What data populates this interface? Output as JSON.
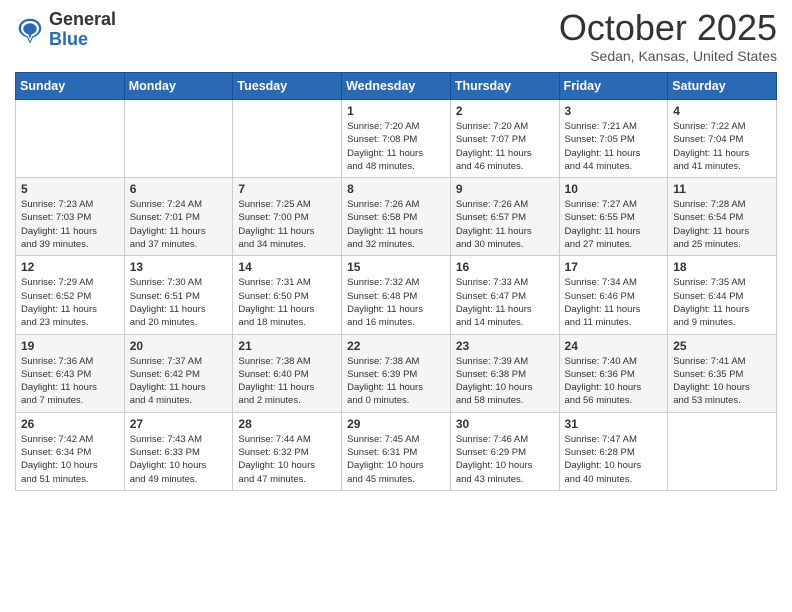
{
  "logo": {
    "general": "General",
    "blue": "Blue"
  },
  "header": {
    "month": "October 2025",
    "location": "Sedan, Kansas, United States"
  },
  "weekdays": [
    "Sunday",
    "Monday",
    "Tuesday",
    "Wednesday",
    "Thursday",
    "Friday",
    "Saturday"
  ],
  "weeks": [
    [
      {
        "day": "",
        "info": ""
      },
      {
        "day": "",
        "info": ""
      },
      {
        "day": "",
        "info": ""
      },
      {
        "day": "1",
        "info": "Sunrise: 7:20 AM\nSunset: 7:08 PM\nDaylight: 11 hours\nand 48 minutes."
      },
      {
        "day": "2",
        "info": "Sunrise: 7:20 AM\nSunset: 7:07 PM\nDaylight: 11 hours\nand 46 minutes."
      },
      {
        "day": "3",
        "info": "Sunrise: 7:21 AM\nSunset: 7:05 PM\nDaylight: 11 hours\nand 44 minutes."
      },
      {
        "day": "4",
        "info": "Sunrise: 7:22 AM\nSunset: 7:04 PM\nDaylight: 11 hours\nand 41 minutes."
      }
    ],
    [
      {
        "day": "5",
        "info": "Sunrise: 7:23 AM\nSunset: 7:03 PM\nDaylight: 11 hours\nand 39 minutes."
      },
      {
        "day": "6",
        "info": "Sunrise: 7:24 AM\nSunset: 7:01 PM\nDaylight: 11 hours\nand 37 minutes."
      },
      {
        "day": "7",
        "info": "Sunrise: 7:25 AM\nSunset: 7:00 PM\nDaylight: 11 hours\nand 34 minutes."
      },
      {
        "day": "8",
        "info": "Sunrise: 7:26 AM\nSunset: 6:58 PM\nDaylight: 11 hours\nand 32 minutes."
      },
      {
        "day": "9",
        "info": "Sunrise: 7:26 AM\nSunset: 6:57 PM\nDaylight: 11 hours\nand 30 minutes."
      },
      {
        "day": "10",
        "info": "Sunrise: 7:27 AM\nSunset: 6:55 PM\nDaylight: 11 hours\nand 27 minutes."
      },
      {
        "day": "11",
        "info": "Sunrise: 7:28 AM\nSunset: 6:54 PM\nDaylight: 11 hours\nand 25 minutes."
      }
    ],
    [
      {
        "day": "12",
        "info": "Sunrise: 7:29 AM\nSunset: 6:52 PM\nDaylight: 11 hours\nand 23 minutes."
      },
      {
        "day": "13",
        "info": "Sunrise: 7:30 AM\nSunset: 6:51 PM\nDaylight: 11 hours\nand 20 minutes."
      },
      {
        "day": "14",
        "info": "Sunrise: 7:31 AM\nSunset: 6:50 PM\nDaylight: 11 hours\nand 18 minutes."
      },
      {
        "day": "15",
        "info": "Sunrise: 7:32 AM\nSunset: 6:48 PM\nDaylight: 11 hours\nand 16 minutes."
      },
      {
        "day": "16",
        "info": "Sunrise: 7:33 AM\nSunset: 6:47 PM\nDaylight: 11 hours\nand 14 minutes."
      },
      {
        "day": "17",
        "info": "Sunrise: 7:34 AM\nSunset: 6:46 PM\nDaylight: 11 hours\nand 11 minutes."
      },
      {
        "day": "18",
        "info": "Sunrise: 7:35 AM\nSunset: 6:44 PM\nDaylight: 11 hours\nand 9 minutes."
      }
    ],
    [
      {
        "day": "19",
        "info": "Sunrise: 7:36 AM\nSunset: 6:43 PM\nDaylight: 11 hours\nand 7 minutes."
      },
      {
        "day": "20",
        "info": "Sunrise: 7:37 AM\nSunset: 6:42 PM\nDaylight: 11 hours\nand 4 minutes."
      },
      {
        "day": "21",
        "info": "Sunrise: 7:38 AM\nSunset: 6:40 PM\nDaylight: 11 hours\nand 2 minutes."
      },
      {
        "day": "22",
        "info": "Sunrise: 7:38 AM\nSunset: 6:39 PM\nDaylight: 11 hours\nand 0 minutes."
      },
      {
        "day": "23",
        "info": "Sunrise: 7:39 AM\nSunset: 6:38 PM\nDaylight: 10 hours\nand 58 minutes."
      },
      {
        "day": "24",
        "info": "Sunrise: 7:40 AM\nSunset: 6:36 PM\nDaylight: 10 hours\nand 56 minutes."
      },
      {
        "day": "25",
        "info": "Sunrise: 7:41 AM\nSunset: 6:35 PM\nDaylight: 10 hours\nand 53 minutes."
      }
    ],
    [
      {
        "day": "26",
        "info": "Sunrise: 7:42 AM\nSunset: 6:34 PM\nDaylight: 10 hours\nand 51 minutes."
      },
      {
        "day": "27",
        "info": "Sunrise: 7:43 AM\nSunset: 6:33 PM\nDaylight: 10 hours\nand 49 minutes."
      },
      {
        "day": "28",
        "info": "Sunrise: 7:44 AM\nSunset: 6:32 PM\nDaylight: 10 hours\nand 47 minutes."
      },
      {
        "day": "29",
        "info": "Sunrise: 7:45 AM\nSunset: 6:31 PM\nDaylight: 10 hours\nand 45 minutes."
      },
      {
        "day": "30",
        "info": "Sunrise: 7:46 AM\nSunset: 6:29 PM\nDaylight: 10 hours\nand 43 minutes."
      },
      {
        "day": "31",
        "info": "Sunrise: 7:47 AM\nSunset: 6:28 PM\nDaylight: 10 hours\nand 40 minutes."
      },
      {
        "day": "",
        "info": ""
      }
    ]
  ]
}
